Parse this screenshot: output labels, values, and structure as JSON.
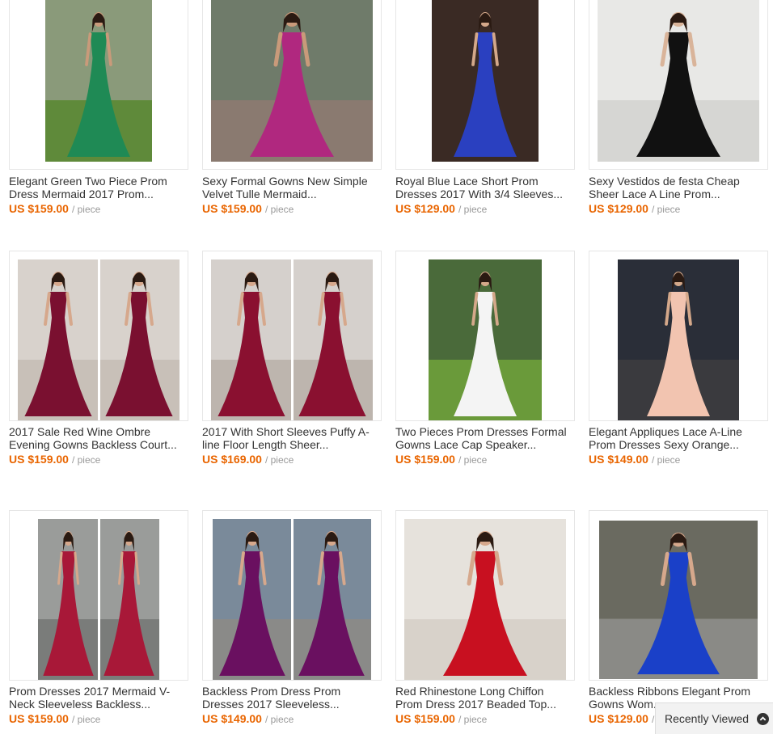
{
  "products": [
    {
      "title_line1": "Elegant Green Two Piece Prom",
      "title_line2": "Dress Mermaid 2017 Prom...",
      "price": "US $159.00",
      "unit": "/ piece",
      "colors": {
        "bg": "#8a9a7a",
        "ground": "#5f8a3a",
        "dress": "#1f8a55",
        "skin": "#c99a7a"
      }
    },
    {
      "title_line1": "Sexy Formal Gowns New Simple",
      "title_line2": "Velvet Tulle Mermaid...",
      "price": "US $159.00",
      "unit": "/ piece",
      "colors": {
        "bg": "#6f7b6a",
        "ground": "#8a7a70",
        "dress": "#b0287f",
        "skin": "#c99a7a"
      }
    },
    {
      "title_line1": "Royal Blue Lace Short Prom",
      "title_line2": "Dresses 2017 With 3/4 Sleeves...",
      "price": "US $129.00",
      "unit": "/ piece",
      "colors": {
        "bg": "#3a2a24",
        "ground": "#3a2a24",
        "dress": "#2a40c0",
        "skin": "#d4a88a"
      }
    },
    {
      "title_line1": "Sexy Vestidos de festa Cheap",
      "title_line2": "Sheer Lace A Line Prom...",
      "price": "US $129.00",
      "unit": "/ piece",
      "colors": {
        "bg": "#e8e8e6",
        "ground": "#d6d6d3",
        "dress": "#111111",
        "skin": "#d9b49a"
      }
    },
    {
      "title_line1": "2017 Sale Red Wine Ombre",
      "title_line2": "Evening Gowns Backless Court...",
      "price": "US $159.00",
      "unit": "/ piece",
      "colors": {
        "bg": "#d8d2cc",
        "ground": "#c8c0b8",
        "dress": "#7a1030",
        "skin": "#d6a88c"
      }
    },
    {
      "title_line1": "2017 With Short Sleeves Puffy A-",
      "title_line2": "line Floor Length Sheer...",
      "price": "US $169.00",
      "unit": "/ piece",
      "colors": {
        "bg": "#d5d0cc",
        "ground": "#bdb5ae",
        "dress": "#8a1030",
        "skin": "#d6a88c"
      }
    },
    {
      "title_line1": "Two Pieces Prom Dresses Formal",
      "title_line2": "Gowns Lace Cap Speaker...",
      "price": "US $159.00",
      "unit": "/ piece",
      "colors": {
        "bg": "#4a6a3a",
        "ground": "#6a9a3a",
        "dress": "#f4f4f4",
        "skin": "#d4a88a"
      }
    },
    {
      "title_line1": "Elegant Appliques Lace A-Line",
      "title_line2": "Prom Dresses Sexy Orange...",
      "price": "US $149.00",
      "unit": "/ piece",
      "colors": {
        "bg": "#2a2e38",
        "ground": "#3a3a3e",
        "dress": "#f2c4b0",
        "skin": "#d4a88a"
      }
    },
    {
      "title_line1": "Prom Dresses 2017 Mermaid V-",
      "title_line2": "Neck Sleeveless Backless...",
      "price": "US $159.00",
      "unit": "/ piece",
      "colors": {
        "bg": "#9a9c9a",
        "ground": "#7a7c7a",
        "dress": "#a81838",
        "skin": "#d6a88c"
      }
    },
    {
      "title_line1": "Backless Prom Dress Prom",
      "title_line2": "Dresses 2017 Sleeveless...",
      "price": "US $149.00",
      "unit": "/ piece",
      "colors": {
        "bg": "#7a8a9a",
        "ground": "#8a8a88",
        "dress": "#6a1060",
        "skin": "#d6a88c"
      }
    },
    {
      "title_line1": "Red Rhinestone Long Chiffon",
      "title_line2": "Prom Dress 2017 Beaded Top...",
      "price": "US $159.00",
      "unit": "/ piece",
      "colors": {
        "bg": "#e6e2dc",
        "ground": "#d8d2ca",
        "dress": "#c81020",
        "skin": "#d6a88c"
      }
    },
    {
      "title_line1": "Backless Ribbons Elegant Prom",
      "title_line2": "Gowns Wom...",
      "price": "US $129.00",
      "unit": "/ piece",
      "colors": {
        "bg": "#6a6a60",
        "ground": "#8a8a86",
        "dress": "#1a40c8",
        "skin": "#d6a88c"
      }
    }
  ],
  "recently_viewed": {
    "label": "Recently Viewed",
    "icon": "chevron-up-circle-icon"
  }
}
